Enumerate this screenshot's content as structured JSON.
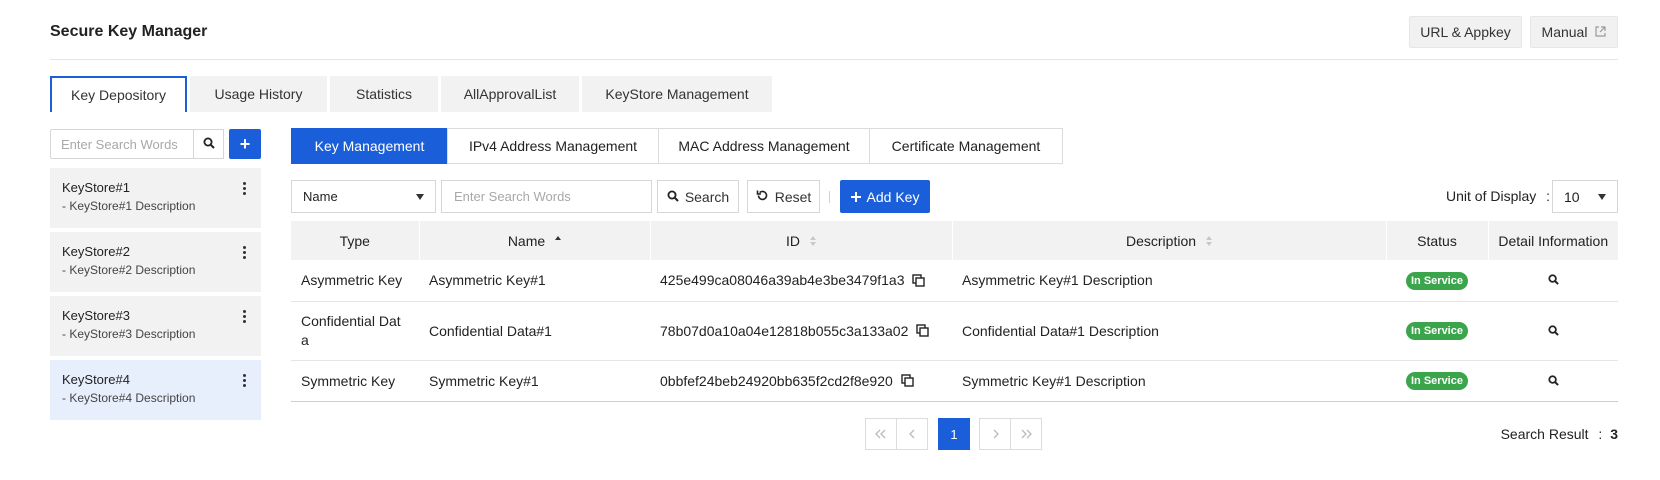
{
  "header": {
    "title": "Secure Key Manager",
    "url_appkey_label": "URL & Appkey",
    "manual_label": "Manual"
  },
  "main_tabs": [
    "Key Depository",
    "Usage History",
    "Statistics",
    "AllApprovalList",
    "KeyStore Management"
  ],
  "sidebar": {
    "search_placeholder": "Enter Search Words",
    "add_label": "+",
    "keystores": [
      {
        "name": "KeyStore#1",
        "description": "- KeyStore#1 Description"
      },
      {
        "name": "KeyStore#2",
        "description": "- KeyStore#2 Description"
      },
      {
        "name": "KeyStore#3",
        "description": "- KeyStore#3 Description"
      },
      {
        "name": "KeyStore#4",
        "description": "- KeyStore#4 Description"
      }
    ]
  },
  "sub_tabs": [
    "Key Management",
    "IPv4 Address Management",
    "MAC Address Management",
    "Certificate Management"
  ],
  "toolbar": {
    "filter_value": "Name",
    "search_placeholder": "Enter Search Words",
    "search_label": "Search",
    "reset_label": "Reset",
    "add_key_label": "Add Key",
    "unit_label": "Unit of Display",
    "unit_sep": ":",
    "unit_value": "10"
  },
  "table": {
    "headers": [
      "Type",
      "Name",
      "ID",
      "Description",
      "Status",
      "Detail Information"
    ],
    "rows": [
      {
        "type": "Asymmetric Key",
        "name": "Asymmetric Key#1",
        "id": "425e499ca08046a39ab4e3be3479f1a3",
        "description": "Asymmetric Key#1 Description",
        "status": "In Service"
      },
      {
        "type": "Confidential Data",
        "name": "Confidential Data#1",
        "id": "78b07d0a10a04e12818b055c3a133a02",
        "description": "Confidential Data#1 Description",
        "status": "In Service"
      },
      {
        "type": "Symmetric Key",
        "name": "Symmetric Key#1",
        "id": "0bbfef24beb24920bb635f2cd2f8e920",
        "description": "Symmetric Key#1 Description",
        "status": "In Service"
      }
    ]
  },
  "pagination": {
    "current_page": "1"
  },
  "search_result": {
    "label": "Search Result",
    "sep": ":",
    "count": "3"
  },
  "colors": {
    "accent": "#1a5fd9",
    "status_green": "#3aa54a",
    "selected_bg": "#e7effc"
  }
}
